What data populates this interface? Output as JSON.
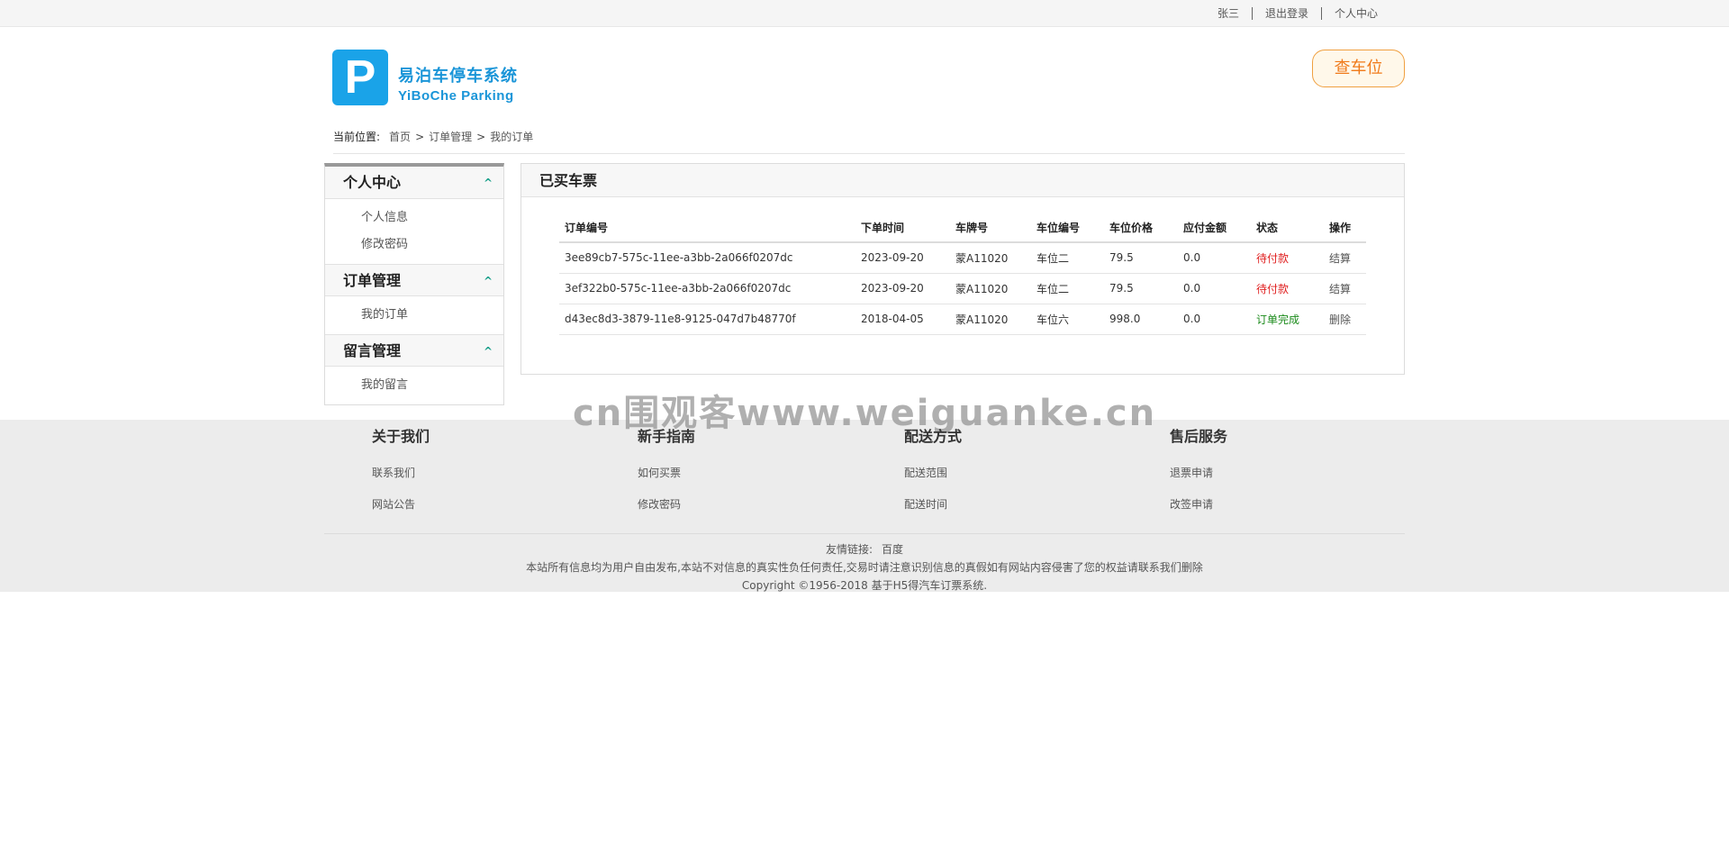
{
  "topbar": {
    "username": "张三",
    "logout": "退出登录",
    "personal_center": "个人中心"
  },
  "logo": {
    "letter": "P",
    "name_cn": "易泊车停车系统",
    "name_en": "YiBoChe  Parking"
  },
  "search_button": "查车位",
  "breadcrumb": {
    "label": "当前位置:",
    "items": [
      "首页",
      "订单管理",
      "我的订单"
    ],
    "separator": ">"
  },
  "sidebar": {
    "groups": [
      {
        "title": "个人中心",
        "items": [
          "个人信息",
          "修改密码"
        ]
      },
      {
        "title": "订单管理",
        "items": [
          "我的订单"
        ]
      },
      {
        "title": "留言管理",
        "items": [
          "我的留言"
        ]
      }
    ],
    "chevron": "^"
  },
  "panel": {
    "title": "已买车票",
    "columns": [
      "订单编号",
      "下单时间",
      "车牌号",
      "车位编号",
      "车位价格",
      "应付金额",
      "状态",
      "操作"
    ],
    "rows": [
      {
        "order_id": "3ee89cb7-575c-11ee-a3bb-2a066f0207dc",
        "time": "2023-09-20",
        "plate": "蒙A11020",
        "spot": "车位二",
        "price": "79.5",
        "payable": "0.0",
        "status": "待付款",
        "action": "结算"
      },
      {
        "order_id": "3ef322b0-575c-11ee-a3bb-2a066f0207dc",
        "time": "2023-09-20",
        "plate": "蒙A11020",
        "spot": "车位二",
        "price": "79.5",
        "payable": "0.0",
        "status": "待付款",
        "action": "结算"
      },
      {
        "order_id": "d43ec8d3-3879-11e8-9125-047d7b48770f",
        "time": "2018-04-05",
        "plate": "蒙A11020",
        "spot": "车位六",
        "price": "998.0",
        "payable": "0.0",
        "status": "订单完成",
        "action": "删除"
      }
    ]
  },
  "watermark": "cn围观客www.weiguanke.cn",
  "footer": {
    "columns": [
      {
        "title": "关于我们",
        "links": [
          "联系我们",
          "网站公告"
        ]
      },
      {
        "title": "新手指南",
        "links": [
          "如何买票",
          "修改密码"
        ]
      },
      {
        "title": "配送方式",
        "links": [
          "配送范围",
          "配送时间"
        ]
      },
      {
        "title": "售后服务",
        "links": [
          "退票申请",
          "改签申请"
        ]
      }
    ],
    "friend_label": "友情链接:",
    "friend_link": "百度",
    "disclaimer": "本站所有信息均为用户自由发布,本站不对信息的真实性负任何责任,交易时请注意识别信息的真假如有网站内容侵害了您的权益请联系我们删除",
    "copyright": "Copyright ©1956-2018 基于H5得汽车订票系统."
  },
  "colors": {
    "brand_blue": "#1aa3e8",
    "accent_orange": "#f07a1a",
    "status_pending": "#e02020",
    "status_done": "#1a8a1a"
  }
}
